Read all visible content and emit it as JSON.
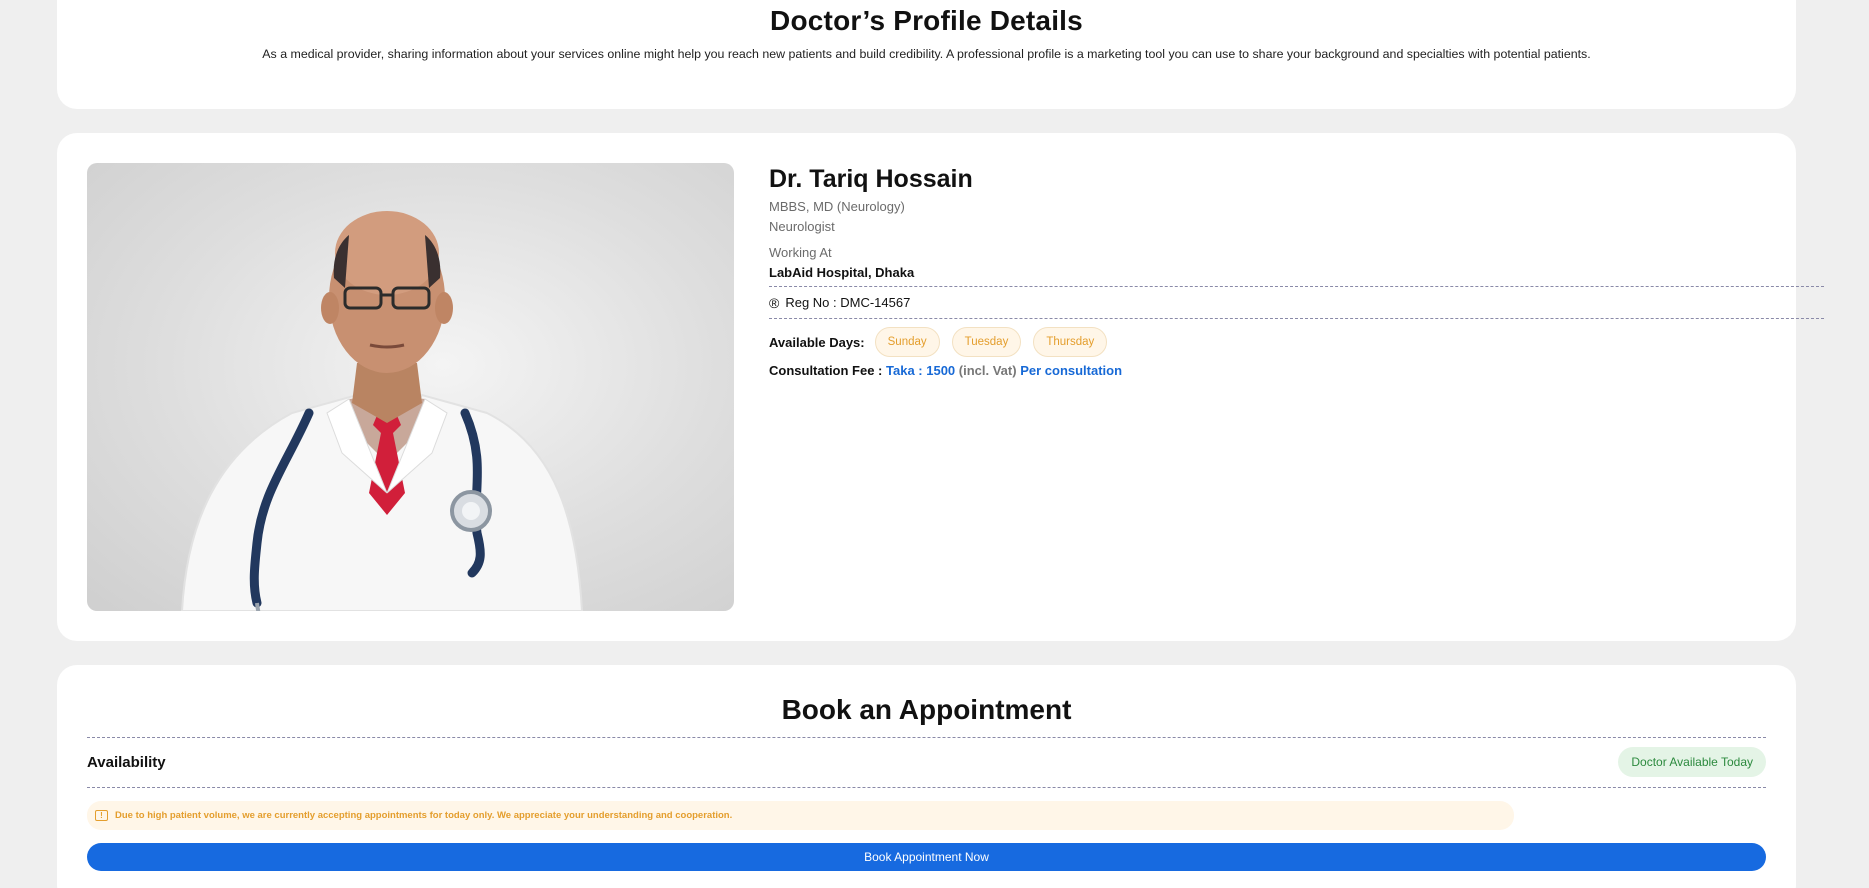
{
  "header": {
    "title": "Doctor’s Profile Details",
    "description": "As a medical provider, sharing information about your services online might help you reach new patients and build credibility. A professional profile is a marketing tool you can use to share your background and specialties with potential patients."
  },
  "profile": {
    "name": "Dr. Tariq Hossain",
    "degree": "MBBS, MD (Neurology)",
    "specialty": "Neurologist",
    "working_at_label": "Working At",
    "hospital": "LabAid Hospital, Dhaka",
    "reg_icon": "registered-icon",
    "reg_no": "Reg No : DMC-14567",
    "available_days_label": "Available Days:",
    "available_days": [
      "Sunday",
      "Tuesday",
      "Thursday"
    ],
    "fee_label": "Consultation Fee :",
    "fee_amount": "Taka : 1500",
    "fee_vat": "(incl. Vat)",
    "fee_per": "Per consultation"
  },
  "booking": {
    "title": "Book an Appointment",
    "availability_label": "Availability",
    "availability_badge": "Doctor Available Today",
    "notice_icon": "alert-icon",
    "notice": "Due to high patient volume, we are currently accepting appointments for today only. We appreciate your understanding and cooperation.",
    "button_label": "Book Appointment Now"
  },
  "colors": {
    "accent_blue": "#176ae0",
    "chip_orange": "#e49e2d",
    "success_green": "#2c8a3e",
    "page_bg": "#efefef"
  }
}
